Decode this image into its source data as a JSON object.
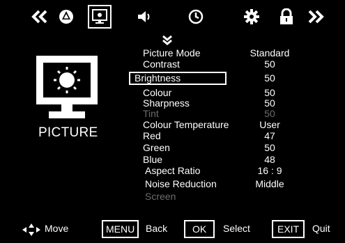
{
  "topbar": {
    "icons": [
      {
        "name": "chevron-left-double-icon"
      },
      {
        "name": "channel-icon"
      },
      {
        "name": "picture-icon",
        "active": true
      },
      {
        "name": "sound-icon"
      },
      {
        "name": "clock-icon"
      },
      {
        "name": "settings-icon"
      },
      {
        "name": "lock-icon"
      },
      {
        "name": "chevron-right-double-icon"
      }
    ]
  },
  "section": {
    "title": "PICTURE"
  },
  "menu": {
    "items": [
      {
        "label": "Picture Mode",
        "value": "Standard"
      },
      {
        "label": "Contrast",
        "value": "50"
      },
      {
        "label": "Brightness",
        "value": "50",
        "selected": true
      },
      {
        "label": "Colour",
        "value": "50"
      },
      {
        "label": "Sharpness",
        "value": "50"
      },
      {
        "label": "Tint",
        "value": "50",
        "disabled": true
      },
      {
        "label": "Colour Temperature",
        "value": "User"
      },
      {
        "label": "Red",
        "value": "47"
      },
      {
        "label": "Green",
        "value": "50"
      },
      {
        "label": "Blue",
        "value": "48"
      },
      {
        "label": "Aspect Ratio",
        "value": "16 : 9"
      },
      {
        "label": "Noise Reduction",
        "value": "Middle"
      },
      {
        "label": "Screen",
        "value": "",
        "disabled": true
      }
    ]
  },
  "footer": {
    "move_label": "Move",
    "menu_key": "MENU",
    "menu_label": "Back",
    "ok_key": "OK",
    "ok_label": "Select",
    "exit_key": "EXIT",
    "exit_label": "Quit"
  },
  "colors": {
    "background": "#000000",
    "foreground": "#ffffff",
    "disabled": "#6d6d6d"
  }
}
